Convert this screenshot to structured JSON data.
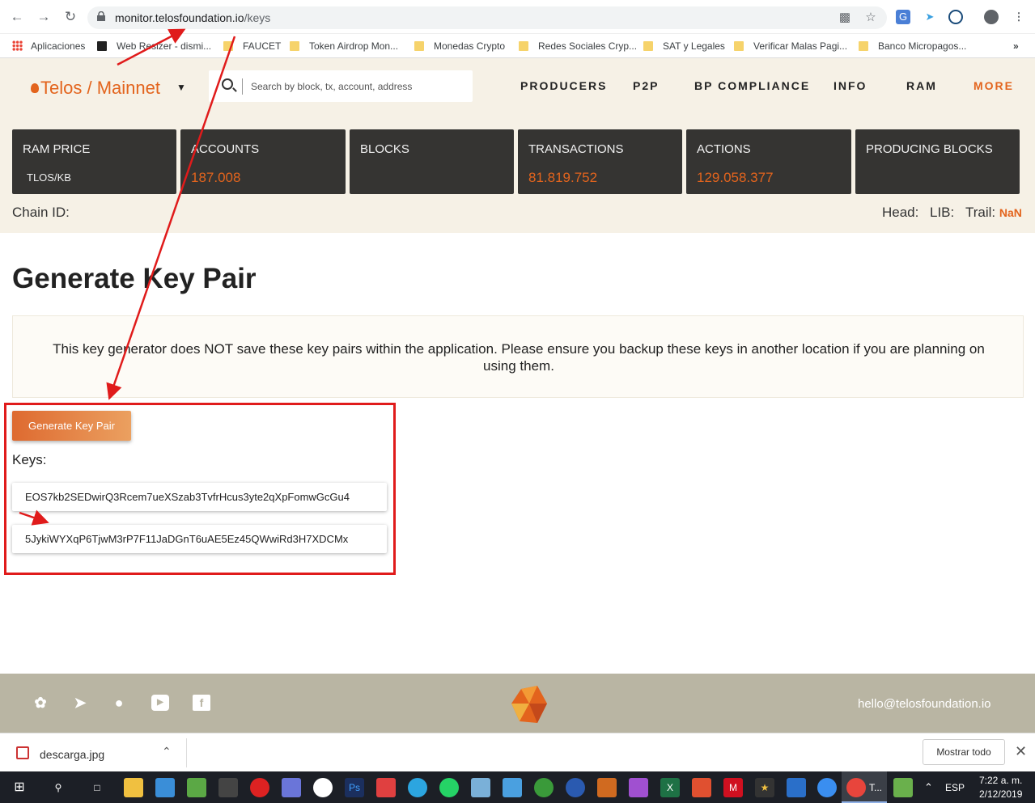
{
  "browser": {
    "url_host": "monitor.telosfoundation.io",
    "url_path": "/keys"
  },
  "bookmarks": [
    "Aplicaciones",
    "Web Resizer - dismi...",
    "FAUCET",
    "Token Airdrop Mon...",
    "Monedas Crypto",
    "Redes Sociales Cryp...",
    "SAT y Legales",
    "Verificar Malas Pagi...",
    "Banco Micropagos..."
  ],
  "site": {
    "logo_brand": "Telos",
    "logo_sep": " / ",
    "logo_network": "Mainnet",
    "search_placeholder": "Search by block, tx, account, address",
    "menu": [
      "PRODUCERS",
      "P2P",
      "BP COMPLIANCE",
      "INFO",
      "RAM",
      "MORE"
    ],
    "stats": [
      {
        "label": "RAM PRICE",
        "sub": "TLOS/KB",
        "value": ""
      },
      {
        "label": "ACCOUNTS",
        "sub": "",
        "value": "187.008"
      },
      {
        "label": "BLOCKS",
        "sub": "",
        "value": ""
      },
      {
        "label": "TRANSACTIONS",
        "sub": "",
        "value": "81.819.752"
      },
      {
        "label": "ACTIONS",
        "sub": "",
        "value": "129.058.377"
      },
      {
        "label": "PRODUCING BLOCKS",
        "sub": "",
        "value": ""
      }
    ],
    "chain_id_label": "Chain ID:",
    "head_label": "Head:",
    "lib_label": "LIB:",
    "trail_label": "Trail:",
    "trail_value": "NaN"
  },
  "main": {
    "title": "Generate Key Pair",
    "notice": "This key generator does NOT save these key pairs within the application. Please ensure you backup these keys in another location if you are planning on using them.",
    "generate_button": "Generate Key Pair",
    "keys_label": "Keys:",
    "public_key": "EOS7kb2SEDwirQ3Rcem7ueXSzab3TvfrHcus3yte2qXpFomwGcGu4",
    "private_key": "5JykiWYXqP6TjwM3rP7F11JaDGnT6uAE5Ez45QWwiRd3H7XDCMx"
  },
  "footer": {
    "email": "hello@telosfoundation.io",
    "social_icons": [
      "twitter-icon",
      "telegram-icon",
      "github-icon",
      "youtube-icon",
      "facebook-icon"
    ]
  },
  "download_bar": {
    "filename": "descarga.jpg",
    "show_all": "Mostrar todo"
  },
  "taskbar": {
    "language": "ESP",
    "time": "7:22 a. m.",
    "date": "2/12/2019",
    "active_label": "T..."
  },
  "colors": {
    "accent": "#e3641d",
    "header_bg": "#f6f1e6",
    "stat_bg": "#353432",
    "footer_bg": "#b9b5a3",
    "annotation": "#e01b1b"
  }
}
